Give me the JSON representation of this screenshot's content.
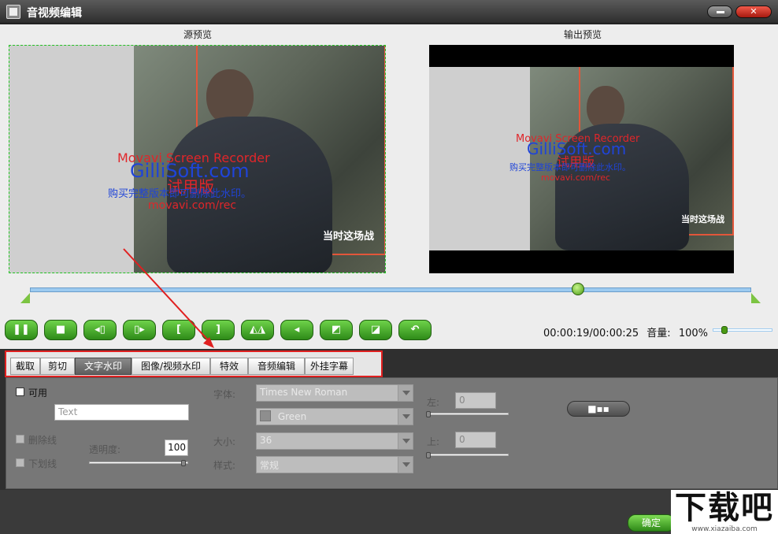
{
  "window": {
    "title": "音视频编辑"
  },
  "preview": {
    "source_label": "源预览",
    "output_label": "输出预览",
    "watermarks": {
      "line1": "Movavi Screen Recorder",
      "line2": "GilliSoft.com",
      "line3": "试用版",
      "line4": "购买完整版本即可删除此水印。",
      "line5": "movavi.com/rec"
    },
    "caption": "当时这场战"
  },
  "playback": {
    "position": 0.76,
    "time": "00:00:19/00:00:25",
    "volume_label": "音量:",
    "volume_value": "100%",
    "volume_fraction": 0.2
  },
  "controls": [
    {
      "name": "pause-button",
      "icon": "pause-icon",
      "glyph": "❚❚"
    },
    {
      "name": "stop-button",
      "icon": "stop-icon",
      "glyph": "■"
    },
    {
      "name": "prev-frame-button",
      "icon": "prev-frame-icon",
      "glyph": "◂▯"
    },
    {
      "name": "next-frame-button",
      "icon": "next-frame-icon",
      "glyph": "▯▸"
    },
    {
      "name": "mark-in-button",
      "icon": "bracket-left-icon",
      "glyph": "["
    },
    {
      "name": "mark-out-button",
      "icon": "bracket-right-icon",
      "glyph": "]"
    },
    {
      "name": "flip-horizontal-button",
      "icon": "flip-horizontal-icon",
      "glyph": "◭◮"
    },
    {
      "name": "rotate-left-button",
      "icon": "arrow-left-icon",
      "glyph": "◂"
    },
    {
      "name": "flip-vertical-button",
      "icon": "flip-vertical-icon",
      "glyph": "◩"
    },
    {
      "name": "flip-mirror-button",
      "icon": "mirror-icon",
      "glyph": "◪"
    },
    {
      "name": "undo-button",
      "icon": "undo-icon",
      "glyph": "↶"
    }
  ],
  "tabs": [
    {
      "label": "截取",
      "active": false
    },
    {
      "label": "剪切",
      "active": false
    },
    {
      "label": "文字水印",
      "active": true
    },
    {
      "label": "图像/视频水印",
      "active": false
    },
    {
      "label": "特效",
      "active": false
    },
    {
      "label": "音频编辑",
      "active": false
    },
    {
      "label": "外挂字幕",
      "active": false
    }
  ],
  "text_watermark": {
    "enable_label": "可用",
    "text_placeholder": "Text",
    "strikethrough_label": "删除线",
    "underline_label": "下划线",
    "opacity_label": "透明度:",
    "opacity_value": "100",
    "font_label": "字体:",
    "font_value": "Times New Roman",
    "color_value": "Green",
    "size_label": "大小:",
    "size_value": "36",
    "style_label": "样式:",
    "style_value": "常规",
    "left_label": "左:",
    "left_value": "0",
    "top_label": "上:",
    "top_value": "0",
    "position_button": "■▪▪"
  },
  "footer": {
    "ok_label": "确定",
    "logo_text": "下载吧",
    "logo_url": "www.xiazaiba.com"
  },
  "colors": {
    "accent_green": "#4a9a14",
    "highlight_red": "#e02020",
    "timeline_blue": "#9ccaf0"
  }
}
